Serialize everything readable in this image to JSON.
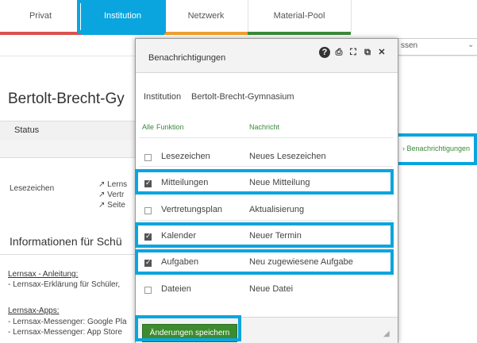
{
  "nav": {
    "tabs": [
      {
        "label": "Privat",
        "color": "#d9534f"
      },
      {
        "label": "Institution",
        "color": "#0aa5de"
      },
      {
        "label": "Netzwerk",
        "color": "#f0a030"
      },
      {
        "label": "Material-Pool",
        "color": "#3b8a3b"
      }
    ]
  },
  "background": {
    "dropdown_partial": "ssen",
    "page_title": "Bertolt-Brecht-Gy",
    "status_header": "Status",
    "lesezeichen_label": "Lesezeichen",
    "lesezeichen_links": [
      "↗ Lerns",
      "↗ Vertr",
      "↗ Seite"
    ],
    "info_heading": "Informationen für Schü",
    "anleitung_title": "Lernsax - Anleitung:",
    "anleitung_link": "- Lernsax-Erklärung für Schüler,",
    "apps_title": "Lernsax-Apps:",
    "apps_links": [
      "- Lernsax-Messenger: Google Pla",
      "- Lernsax-Messenger: App Store"
    ],
    "benachrichtigungen_link": "› Benachrichtigungen"
  },
  "modal": {
    "title": "Benachrichtigungen",
    "institution_label": "Institution",
    "institution_value": "Bertolt-Brecht-Gymnasium",
    "col_alle": "Alle",
    "col_funktion": "Funktion",
    "col_nachricht": "Nachricht",
    "rows": [
      {
        "funktion": "Lesezeichen",
        "nachricht": "Neues Lesezeichen",
        "checked": false
      },
      {
        "funktion": "Mitteilungen",
        "nachricht": "Neue Mitteilung",
        "checked": true
      },
      {
        "funktion": "Vertretungsplan",
        "nachricht": "Aktualisierung",
        "checked": false
      },
      {
        "funktion": "Kalender",
        "nachricht": "Neuer Termin",
        "checked": true
      },
      {
        "funktion": "Aufgaben",
        "nachricht": "Neu zugewiesene Aufgabe",
        "checked": true
      },
      {
        "funktion": "Dateien",
        "nachricht": "Neue Datei",
        "checked": false
      }
    ],
    "save_label": "Änderungen speichern",
    "icons": [
      "help-icon",
      "print-icon",
      "expand-icon",
      "popout-icon",
      "close-icon"
    ]
  },
  "accent_color": "#0aa5de"
}
